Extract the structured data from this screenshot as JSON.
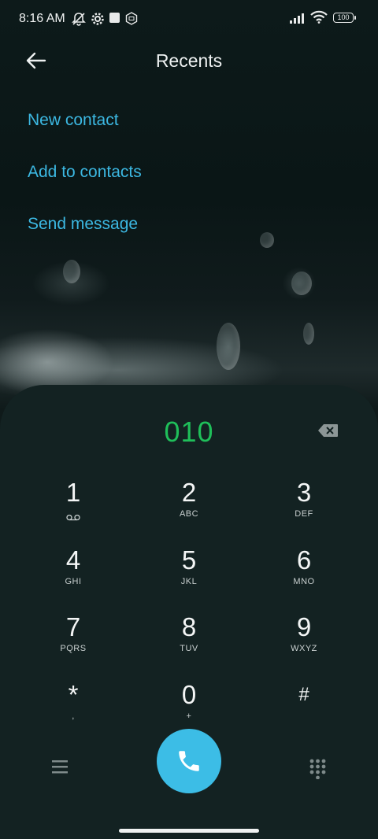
{
  "status_bar": {
    "time": "8:16 AM",
    "battery": "100",
    "icons": [
      "mute-bell-icon",
      "gear-icon",
      "square-icon",
      "hexagon-icon",
      "signal-icon",
      "wifi-icon",
      "battery-icon"
    ]
  },
  "header": {
    "title": "Recents",
    "back_icon": "arrow-left-icon"
  },
  "actions": {
    "new_contact": "New contact",
    "add_to_contacts": "Add to contacts",
    "send_message": "Send message"
  },
  "dialer": {
    "number": "010",
    "keys": [
      {
        "digit": "1",
        "letters": ""
      },
      {
        "digit": "2",
        "letters": "ABC"
      },
      {
        "digit": "3",
        "letters": "DEF"
      },
      {
        "digit": "4",
        "letters": "GHI"
      },
      {
        "digit": "5",
        "letters": "JKL"
      },
      {
        "digit": "6",
        "letters": "MNO"
      },
      {
        "digit": "7",
        "letters": "PQRS"
      },
      {
        "digit": "8",
        "letters": "TUV"
      },
      {
        "digit": "9",
        "letters": "WXYZ"
      },
      {
        "digit": "*",
        "letters": ","
      },
      {
        "digit": "0",
        "letters": "+"
      },
      {
        "digit": "#",
        "letters": ""
      }
    ]
  },
  "colors": {
    "accent": "#3cb8e2",
    "number": "#1fbf5a",
    "call_button": "#3cbde6",
    "panel": "#132222"
  }
}
